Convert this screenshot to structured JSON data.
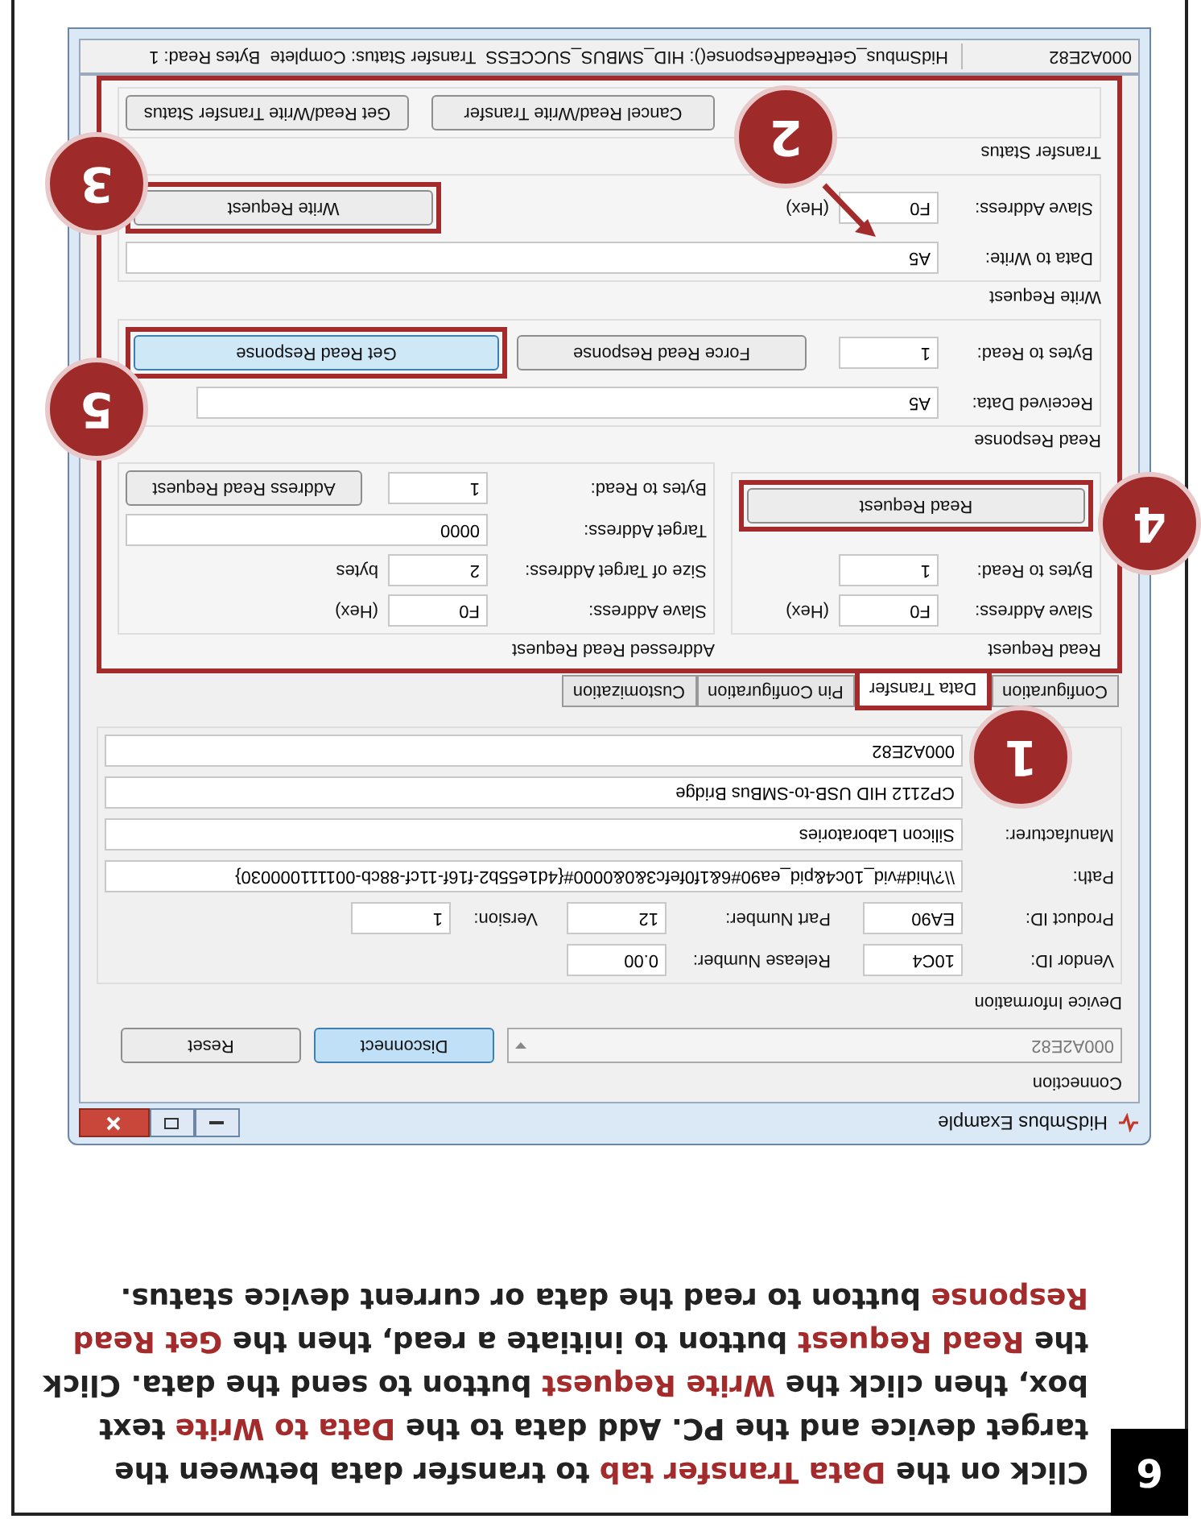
{
  "step": {
    "number": "6",
    "paragraph": [
      {
        "text": "Click on the ",
        "highlight": false
      },
      {
        "text": "Data Transfer tab",
        "highlight": true
      },
      {
        "text": " to transfer data between the target device and the PC. Add data to the ",
        "highlight": false
      },
      {
        "text": "Data to Write",
        "highlight": true
      },
      {
        "text": " text box, then click the ",
        "highlight": false
      },
      {
        "text": "Write Request",
        "highlight": true
      },
      {
        "text": " button to send the data. Click the ",
        "highlight": false
      },
      {
        "text": "Read Request",
        "highlight": true
      },
      {
        "text": " button to initiate a read, then the ",
        "highlight": false
      },
      {
        "text": "Get Read Response",
        "highlight": true
      },
      {
        "text": " button to read the data or current device status.",
        "highlight": false
      }
    ]
  },
  "window": {
    "title": "HidSmbus Example",
    "connection": {
      "title": "Connection",
      "device": "000A2E82",
      "buttons": [
        {
          "label": "Disconnect",
          "focused": true
        },
        {
          "label": "Reset",
          "focused": false
        }
      ]
    },
    "device_information": {
      "title": "Device Information",
      "vendor_id": {
        "label": "Vendor ID:",
        "value": "10C4"
      },
      "release_number": {
        "label": "Release Number:",
        "value": "0.00"
      },
      "product_id": {
        "label": "Product ID:",
        "value": "EA90"
      },
      "part_number": {
        "label": "Part Number:",
        "value": "12"
      },
      "version": {
        "label": "Version:",
        "value": "1"
      },
      "path": {
        "label": "Path:",
        "value": "\\\\?\\hid#vid_10c4&pid_ea90#6&1f0fefc3&0&0000#{4d1e55b2-f16f-11cf-88cb-001111000030}"
      },
      "manufacturer": {
        "label": "Manufacturer:",
        "value": "Silicon Laboratories"
      },
      "product": {
        "value": "CP2112 HID USB-to-SMBus Bridge"
      },
      "serial": {
        "value": "000A2E82"
      }
    },
    "tabs": [
      {
        "label": "Configuration",
        "selected": false
      },
      {
        "label": "Data Transfer",
        "selected": true
      },
      {
        "label": "Pin Configuration",
        "selected": false
      },
      {
        "label": "Customization",
        "selected": false
      }
    ],
    "data_transfer": {
      "read_request": {
        "title": "Read Request",
        "slave_address": {
          "label": "Slave Address:",
          "value": "F0",
          "unit": "(Hex)"
        },
        "bytes_to_read": {
          "label": "Bytes to Read:",
          "value": "1"
        },
        "button": "Read Request"
      },
      "addressed_read_request": {
        "title": "Addressed Read Request",
        "slave_address": {
          "label": "Slave Address:",
          "value": "F0",
          "unit": "(Hex)"
        },
        "size_of_target_address": {
          "label": "Size of Target Address:",
          "value": "2",
          "unit": "bytes"
        },
        "target_address": {
          "label": "Target Address:",
          "value": "0000"
        },
        "bytes_to_read": {
          "label": "Bytes to Read:",
          "value": "1"
        },
        "button": "Address Read Request"
      },
      "read_response": {
        "title": "Read Response",
        "received_data": {
          "label": "Received Data:",
          "value": "A5"
        },
        "bytes_to_read": {
          "label": "Bytes to Read:",
          "value": "1"
        },
        "buttons": [
          "Force Read Response",
          "Get Read Response"
        ]
      },
      "write_request": {
        "title": "Write Request",
        "data_to_write": {
          "label": "Data to Write:",
          "value": "A5"
        },
        "slave_address": {
          "label": "Slave Address:",
          "value": "F0",
          "unit": "(Hex)"
        },
        "button": "Write Request"
      },
      "transfer_status": {
        "title": "Transfer Status",
        "buttons": [
          "Cancel Read/Write Transfer",
          "Get Read/Write Transfer Status"
        ]
      }
    },
    "status_bar": [
      "000A2E82",
      "HidSmbus_GetReadResponse(): HID_SMBUS_SUCCESS  Transfer Status: Complete  Bytes Read: 1"
    ]
  },
  "callouts": [
    {
      "number": "1"
    },
    {
      "number": "2"
    },
    {
      "number": "3"
    },
    {
      "number": "4"
    },
    {
      "number": "5"
    }
  ]
}
